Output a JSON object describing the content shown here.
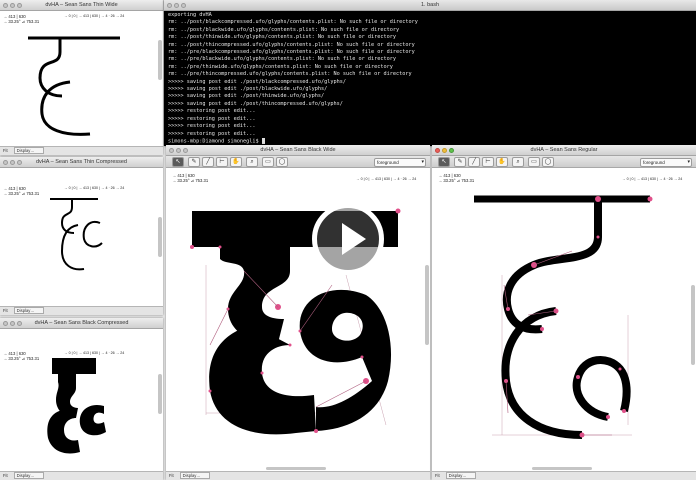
{
  "windows": {
    "thin_wide": {
      "title": "dvHA – Sean Sans Thin Wide",
      "coords_line1": "→ 413 | 630",
      "coords_line2": "→ 33.25° ⊿ 753.31",
      "coords_right": "→ 0 | 0 | → 413 | 630 | → 4 · 26 → 24",
      "bottom_label": "Fit",
      "bottom_dropdown": "Display…"
    },
    "thin_compressed": {
      "title": "dvHA – Sean Sans Thin Compressed",
      "coords_line1": "→ 413 | 630",
      "coords_line2": "→ 33.25° ⊿ 753.31",
      "coords_right": "→ 0 | 0 | → 413 | 630 | → 4 · 26 → 24",
      "bottom_label": "Fit",
      "bottom_dropdown": "Display…"
    },
    "black_compressed": {
      "title": "dvHA – Sean Sans Black Compressed",
      "coords_line1": "→ 413 | 630",
      "coords_line2": "→ 33.25° ⊿ 753.31",
      "coords_right": "→ 0 | 0 | → 413 | 630 | → 4 · 26 → 24",
      "bottom_label": "Fit",
      "bottom_dropdown": "Display…"
    },
    "black_wide": {
      "title": "dvHA – Sean Sans Black Wide",
      "layer": "foreground",
      "coords_line1": "→ 413 | 630",
      "coords_line2": "→ 33.25° ⊿ 753.31",
      "coords_right": "→ 0 | 0 | → 413 | 630 | → 4 · 26 → 24",
      "bottom_label": "Fit",
      "bottom_dropdown": "Display…"
    },
    "regular": {
      "title": "dvHA – Sean Sans Regular",
      "layer": "foreground",
      "coords_line1": "→ 413 | 630",
      "coords_line2": "→ 33.25° ⊿ 753.31",
      "coords_right": "→ 0 | 0 | → 413 | 630 | → 4 · 26 → 24",
      "bottom_label": "Fit",
      "bottom_dropdown": "Display…"
    }
  },
  "terminal": {
    "title": "1. bash",
    "lines": [
      "exporting dvHA",
      "rm: ../post/blackcompressed.ufo/glyphs/contents.plist: No such file or directory",
      "rm: ../post/blackwide.ufo/glyphs/contents.plist: No such file or directory",
      "rm: ../post/thinwide.ufo/glyphs/contents.plist: No such file or directory",
      "rm: ../post/thincompressed.ufo/glyphs/contents.plist: No such file or directory",
      "rm: ../pre/blackcompressed.ufo/glyphs/contents.plist: No such file or directory",
      "rm: ../pre/blackwide.ufo/glyphs/contents.plist: No such file or directory",
      "rm: ../pre/thinwide.ufo/glyphs/contents.plist: No such file or directory",
      "rm: ../pre/thincompressed.ufo/glyphs/contents.plist: No such file or directory",
      ">>>>> saving post edit ./post/blackcompressed.ufo/glyphs/",
      ">>>>> saving post edit ./post/blackwide.ufo/glyphs/",
      ">>>>> saving post edit ./post/thinwide.ufo/glyphs/",
      ">>>>> saving post edit ./post/thincompressed.ufo/glyphs/",
      ">>>>> restoring post edit...",
      ">>>>> restoring post edit...",
      ">>>>> restoring post edit...",
      ">>>>> restoring post edit...",
      "simons-mbp:Diamond simonegli$ "
    ]
  },
  "toolbar_icons": [
    "pointer-tool-icon",
    "pen-tool-icon",
    "knife-tool-icon",
    "ruler-tool-icon",
    "hand-tool-icon",
    "zoom-tool-icon",
    "rectangle-tool-icon",
    "ellipse-tool-icon"
  ],
  "colors": {
    "glyph": "#000000",
    "point": "#e0508a",
    "handle": "#b06080",
    "guide": "#c9a0b0"
  }
}
